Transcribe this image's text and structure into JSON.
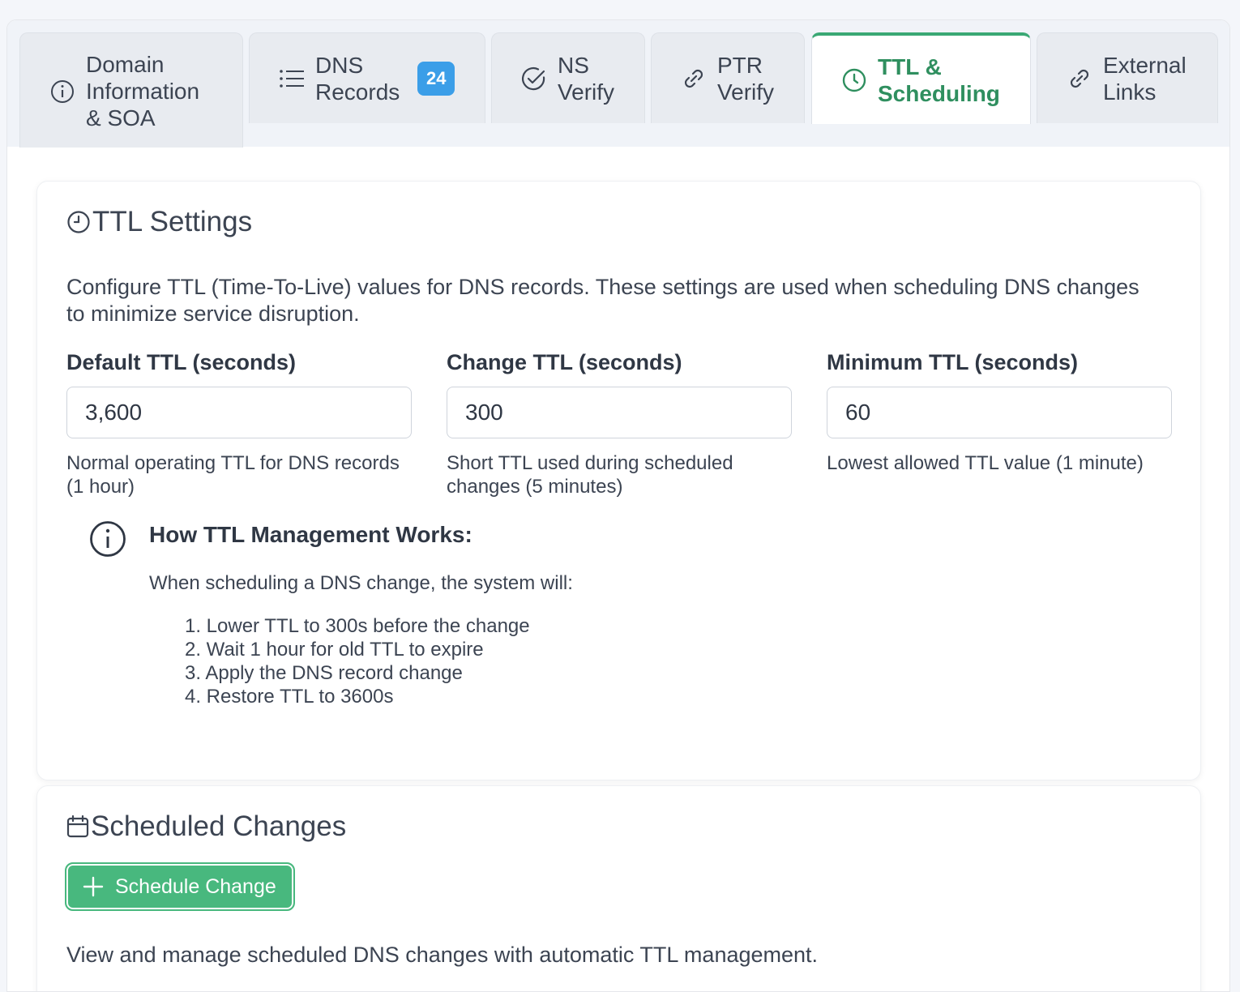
{
  "tabs": [
    {
      "label": "Domain Information & SOA",
      "icon": "info-icon",
      "active": false
    },
    {
      "label": "DNS Records",
      "icon": "list-icon",
      "badge": "24",
      "active": false
    },
    {
      "label": "NS Verify",
      "icon": "check-circle-icon",
      "active": false
    },
    {
      "label": "PTR Verify",
      "icon": "link-icon",
      "active": false
    },
    {
      "label": "TTL & Scheduling",
      "icon": "clock-icon",
      "active": true
    },
    {
      "label": "External Links",
      "icon": "link-icon",
      "active": false
    }
  ],
  "tab_lines": {
    "domain": [
      "Domain",
      "Information",
      "& SOA"
    ],
    "dns": [
      "DNS",
      "Records"
    ],
    "ns": [
      "NS",
      "Verify"
    ],
    "ptr": [
      "PTR",
      "Verify"
    ],
    "ttl": [
      "TTL &",
      "Scheduling"
    ],
    "external": [
      "External",
      "Links"
    ]
  },
  "ttl_settings": {
    "title": "TTL Settings",
    "description": "Configure TTL (Time-To-Live) values for DNS records. These settings are used when scheduling DNS changes to minimize service disruption.",
    "fields": [
      {
        "label": "Default TTL (seconds)",
        "value": "3,600",
        "help": "Normal operating TTL for DNS records (1 hour)"
      },
      {
        "label": "Change TTL (seconds)",
        "value": "300",
        "help": "Short TTL used during scheduled changes (5 minutes)"
      },
      {
        "label": "Minimum TTL (seconds)",
        "value": "60",
        "help": "Lowest allowed TTL value (1 minute)"
      }
    ],
    "info": {
      "title": "How TTL Management Works:",
      "intro": "When scheduling a DNS change, the system will:",
      "steps": [
        "1. Lower TTL to 300s before the change",
        "2. Wait 1 hour for old TTL to expire",
        "3. Apply the DNS record change",
        "4. Restore TTL to 3600s"
      ]
    }
  },
  "scheduled_changes": {
    "title": "Scheduled Changes",
    "button_label": "Schedule Change",
    "description": "View and manage scheduled DNS changes with automatic TTL management."
  },
  "colors": {
    "accent": "#3aa874",
    "badge": "#3b9ee8",
    "button": "#48b87e"
  }
}
